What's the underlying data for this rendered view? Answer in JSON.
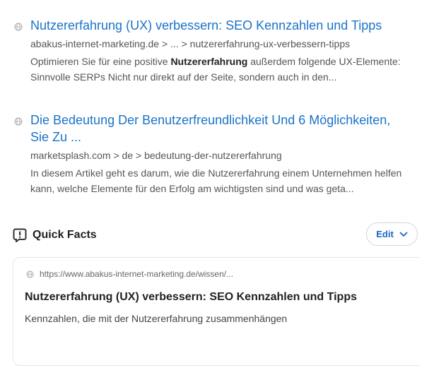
{
  "results": [
    {
      "title": "Nutzererfahrung (UX) verbessern: SEO Kennzahlen und Tipps",
      "url": "abakus-internet-marketing.de > ... > nutzererfahrung-ux-verbessern-tipps",
      "snippet_pre": "Optimieren Sie für eine positive ",
      "snippet_bold": "Nutzererfahrung",
      "snippet_post": " außerdem folgende UX-Elemente: Sinnvolle SERPs Nicht nur direkt auf der Seite, sondern auch in den..."
    },
    {
      "title": "Die Bedeutung Der Benutzerfreundlichkeit Und 6 Möglichkeiten, Sie Zu ...",
      "url": "marketsplash.com > de > bedeutung-der-nutzererfahrung",
      "snippet": "In diesem Artikel geht es darum, wie die Nutzererfahrung einem Unternehmen helfen kann, welche Elemente für den Erfolg am wichtigsten sind und was geta..."
    }
  ],
  "quick_facts": {
    "title": "Quick Facts",
    "edit_label": "Edit",
    "card": {
      "source_url": "https://www.abakus-internet-marketing.de/wissen/...",
      "title": "Nutzererfahrung (UX) verbessern: SEO Kennzahlen und Tipps",
      "text": "Kennzahlen, die mit der Nutzererfahrung zusammenhängen"
    }
  },
  "colors": {
    "link": "#1a73c9",
    "edit_accent": "#1a66c2"
  },
  "icons": {
    "result_favicon": "globe-icon",
    "quick_facts": "info-badge-icon",
    "edit_chevron": "chevron-down-icon"
  }
}
